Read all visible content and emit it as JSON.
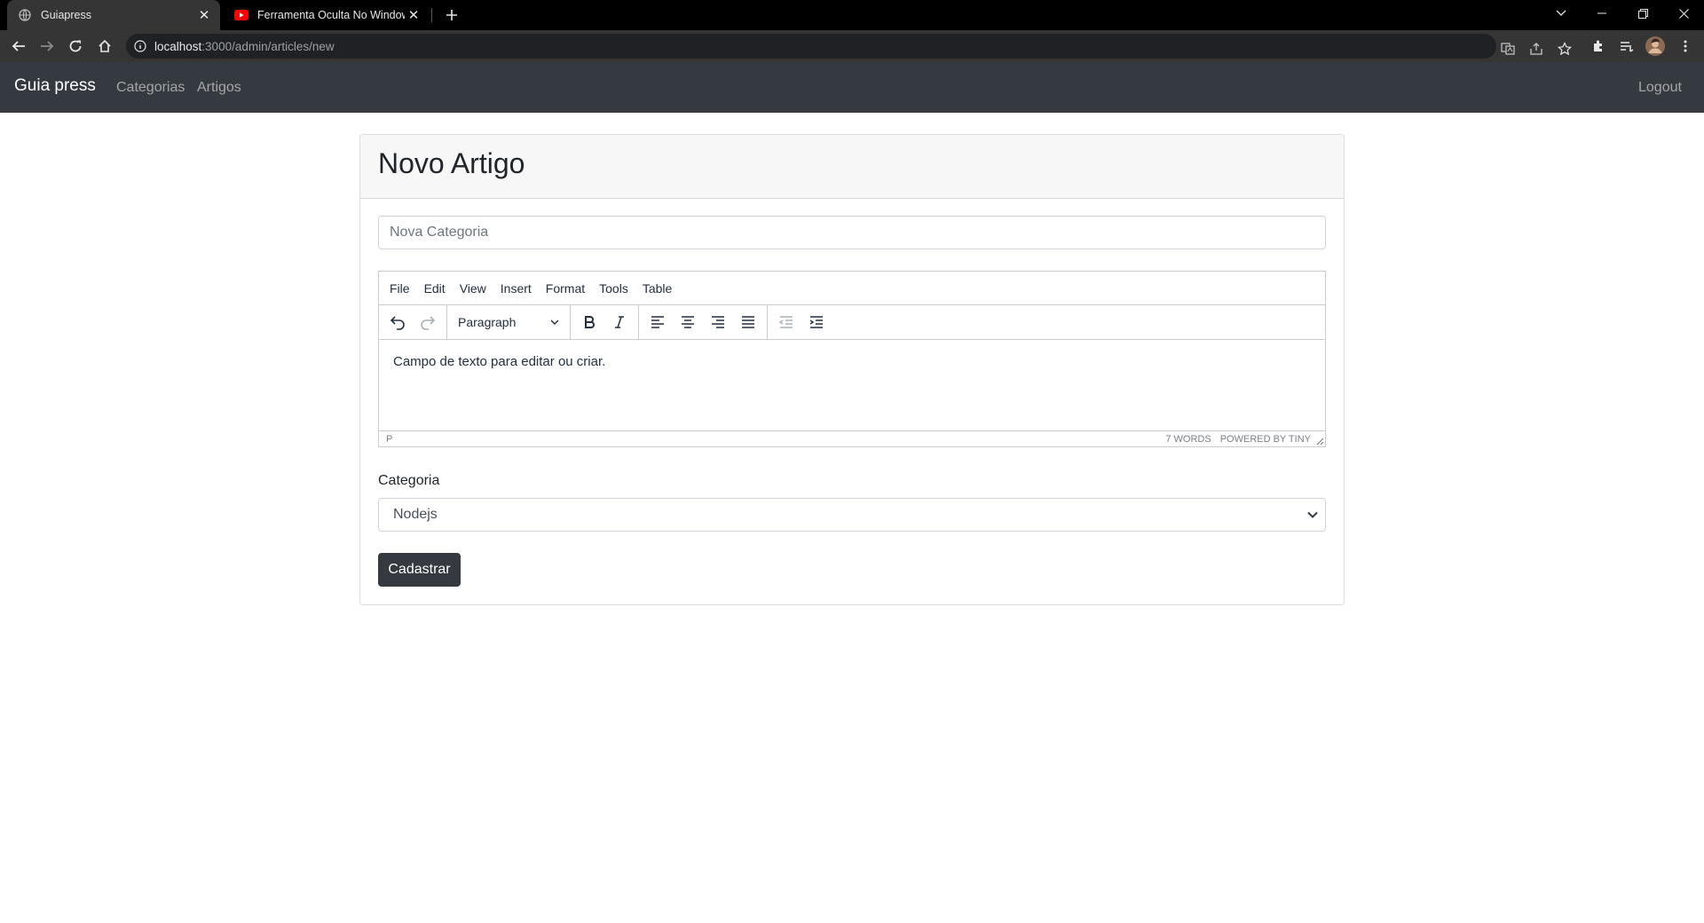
{
  "browser": {
    "tabs": [
      {
        "title": "Guiapress",
        "favicon": "globe-icon",
        "active": true
      },
      {
        "title": "Ferramenta Oculta No Windows",
        "favicon": "youtube-icon",
        "active": false
      }
    ],
    "url_host": "localhost",
    "url_path": ":3000/admin/articles/new"
  },
  "navbar": {
    "brand": "Guia press",
    "links": [
      "Categorias",
      "Artigos"
    ],
    "logout": "Logout"
  },
  "page": {
    "heading": "Novo Artigo",
    "title_placeholder": "Nova Categoria",
    "editor": {
      "menu": [
        "File",
        "Edit",
        "View",
        "Insert",
        "Format",
        "Tools",
        "Table"
      ],
      "block_format": "Paragraph",
      "content": "Campo de texto para editar ou criar.",
      "status_path": "P",
      "word_count": "7 WORDS",
      "powered_by": "POWERED BY TINY"
    },
    "category_label": "Categoria",
    "category_selected": "Nodejs",
    "submit_label": "Cadastrar"
  },
  "colors": {
    "navbar_bg": "#343a40",
    "button_bg": "#343a40",
    "card_header_bg": "#f7f7f7"
  }
}
